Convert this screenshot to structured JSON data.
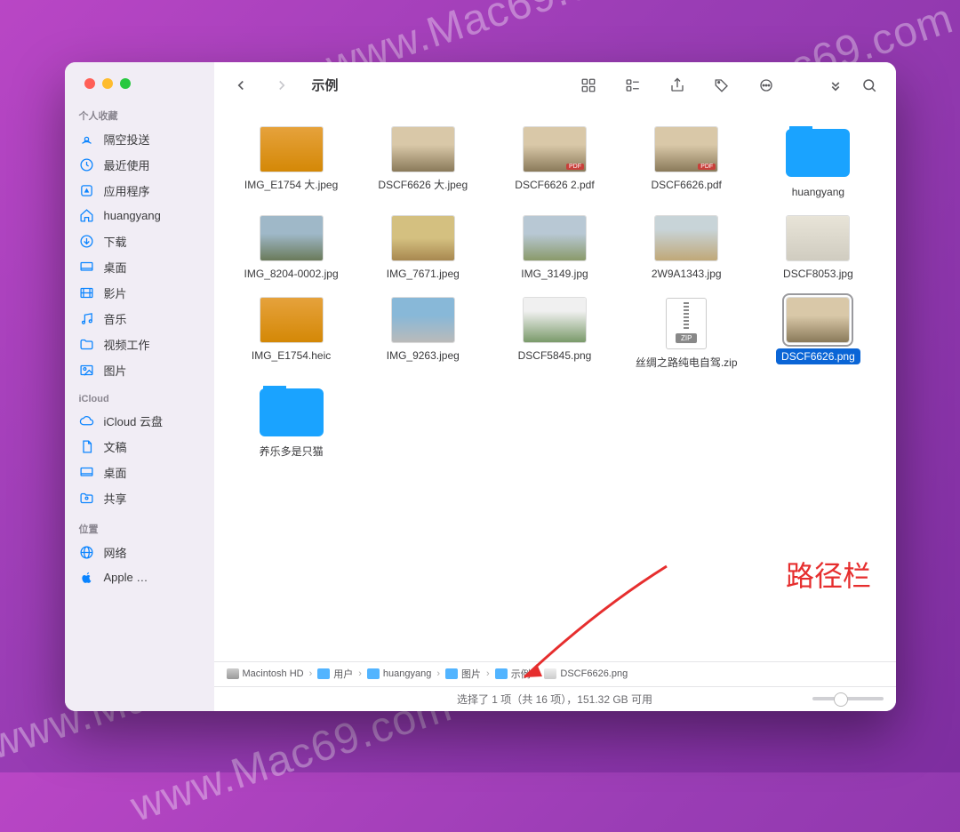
{
  "window_title": "示例",
  "sidebar": {
    "sections": [
      {
        "heading": "个人收藏",
        "items": [
          {
            "label": "隔空投送",
            "icon": "airdrop"
          },
          {
            "label": "最近使用",
            "icon": "clock"
          },
          {
            "label": "应用程序",
            "icon": "app"
          },
          {
            "label": "huangyang",
            "icon": "home"
          },
          {
            "label": "下载",
            "icon": "download"
          },
          {
            "label": "桌面",
            "icon": "desktop"
          },
          {
            "label": "影片",
            "icon": "movie"
          },
          {
            "label": "音乐",
            "icon": "music"
          },
          {
            "label": "视频工作",
            "icon": "folder"
          },
          {
            "label": "图片",
            "icon": "photo"
          }
        ]
      },
      {
        "heading": "iCloud",
        "items": [
          {
            "label": "iCloud 云盘",
            "icon": "cloud"
          },
          {
            "label": "文稿",
            "icon": "doc"
          },
          {
            "label": "桌面",
            "icon": "desktop"
          },
          {
            "label": "共享",
            "icon": "shared"
          }
        ]
      },
      {
        "heading": "位置",
        "items": [
          {
            "label": "网络",
            "icon": "network"
          },
          {
            "label": "Apple …",
            "icon": "apple"
          }
        ]
      }
    ]
  },
  "files": [
    {
      "name": "IMG_E1754 大.jpeg",
      "kind": "img",
      "th": "th-orange"
    },
    {
      "name": "DSCF6626 大.jpeg",
      "kind": "img",
      "th": "th-room"
    },
    {
      "name": "DSCF6626 2.pdf",
      "kind": "pdf",
      "th": "th-room"
    },
    {
      "name": "DSCF6626.pdf",
      "kind": "pdf",
      "th": "th-room"
    },
    {
      "name": "huangyang",
      "kind": "folder"
    },
    {
      "name": "IMG_8204-0002.jpg",
      "kind": "img",
      "th": "th-outdoor1"
    },
    {
      "name": "IMG_7671.jpeg",
      "kind": "img",
      "th": "th-desert"
    },
    {
      "name": "IMG_3149.jpg",
      "kind": "img",
      "th": "th-field"
    },
    {
      "name": "2W9A1343.jpg",
      "kind": "img",
      "th": "th-tent"
    },
    {
      "name": "DSCF8053.jpg",
      "kind": "img",
      "th": "th-head"
    },
    {
      "name": "IMG_E1754.heic",
      "kind": "img",
      "th": "th-orange"
    },
    {
      "name": "IMG_9263.jpeg",
      "kind": "img",
      "th": "th-person"
    },
    {
      "name": "DSCF5845.png",
      "kind": "img",
      "th": "th-plant"
    },
    {
      "name": "丝绸之路纯电自驾.zip",
      "kind": "zip"
    },
    {
      "name": "DSCF6626.png",
      "kind": "img",
      "th": "th-room",
      "selected": true
    },
    {
      "name": "养乐多是只猫",
      "kind": "folder"
    }
  ],
  "pathbar": [
    {
      "label": "Macintosh HD",
      "icon": "hd"
    },
    {
      "label": "用户",
      "icon": "folder"
    },
    {
      "label": "huangyang",
      "icon": "folder"
    },
    {
      "label": "图片",
      "icon": "folder"
    },
    {
      "label": "示例",
      "icon": "folder"
    },
    {
      "label": "DSCF6626.png",
      "icon": "file"
    }
  ],
  "status": "选择了 1 项（共 16 项），151.32 GB 可用",
  "annotation": "路径栏",
  "zip_badge": "ZIP",
  "pdf_badge": "PDF",
  "watermark": "www.Mac69.com"
}
